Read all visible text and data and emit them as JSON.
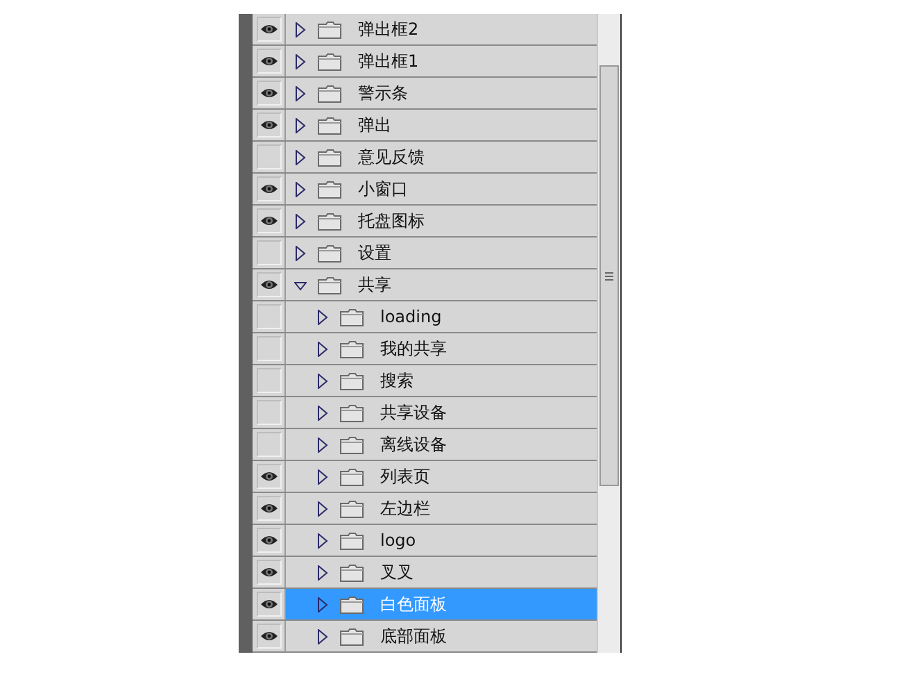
{
  "layers": [
    {
      "name": "弹出框2",
      "visible": true,
      "expanded": false,
      "selected": false
    },
    {
      "name": "弹出框1",
      "visible": true,
      "expanded": false,
      "selected": false
    },
    {
      "name": "警示条",
      "visible": true,
      "expanded": false,
      "selected": false
    },
    {
      "name": "弹出",
      "visible": true,
      "expanded": false,
      "selected": false
    },
    {
      "name": "意见反馈",
      "visible": false,
      "expanded": false,
      "selected": false
    },
    {
      "name": "小窗口",
      "visible": true,
      "expanded": false,
      "selected": false
    },
    {
      "name": "托盘图标",
      "visible": true,
      "expanded": false,
      "selected": false
    },
    {
      "name": "设置",
      "visible": false,
      "expanded": false,
      "selected": false
    },
    {
      "name": "共享",
      "visible": true,
      "expanded": true,
      "selected": false,
      "children": [
        {
          "name": "loading",
          "visible": false,
          "expanded": false,
          "selected": false
        },
        {
          "name": "我的共享",
          "visible": false,
          "expanded": false,
          "selected": false
        },
        {
          "name": "搜索",
          "visible": false,
          "expanded": false,
          "selected": false
        },
        {
          "name": "共享设备",
          "visible": false,
          "expanded": false,
          "selected": false
        },
        {
          "name": "离线设备",
          "visible": false,
          "expanded": false,
          "selected": false
        },
        {
          "name": "列表页",
          "visible": true,
          "expanded": false,
          "selected": false
        },
        {
          "name": "左边栏",
          "visible": true,
          "expanded": false,
          "selected": false
        },
        {
          "name": "logo",
          "visible": true,
          "expanded": false,
          "selected": false
        },
        {
          "name": "叉叉",
          "visible": true,
          "expanded": false,
          "selected": false
        },
        {
          "name": "白色面板",
          "visible": true,
          "expanded": false,
          "selected": true
        },
        {
          "name": "底部面板",
          "visible": true,
          "expanded": false,
          "selected": false
        }
      ]
    }
  ]
}
